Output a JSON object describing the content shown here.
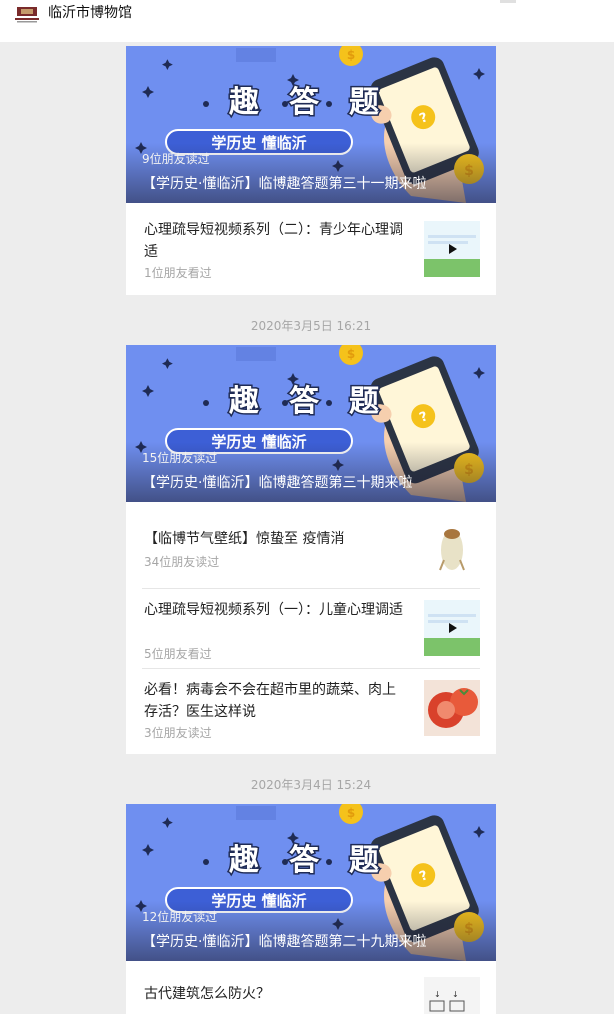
{
  "header": {
    "title": "临沂市博物馆",
    "logo_icon": "museum-logo-icon"
  },
  "colors": {
    "hero_blue": "#6f8ff0",
    "coin": "#f5c21b",
    "pill": "#3d5fd6"
  },
  "groups": [
    {
      "date": "",
      "hero": {
        "banner_text": "趣答题",
        "banner_sub": "学历史·懂临沂",
        "read": "9位朋友读过",
        "title": "【学历史·懂临沂】临博趣答题第三十一期来啦"
      },
      "items": [
        {
          "title": "心理疏导短视频系列（二）：青少年心理调适",
          "read": "1位朋友看过",
          "thumb": "video-thumbnail"
        }
      ]
    },
    {
      "date": "2020年3月5日 16:21",
      "hero": {
        "banner_text": "趣答题",
        "banner_sub": "学历史·懂临沂",
        "read": "15位朋友读过",
        "title": "【学历史·懂临沂】临博趣答题第三十期来啦"
      },
      "items": [
        {
          "title": "【临博节气壁纸】惊蛰至  疫情消",
          "read": "34位朋友读过",
          "thumb": "cicada-thumbnail"
        },
        {
          "title": "心理疏导短视频系列（一）：儿童心理调适",
          "read": "5位朋友看过",
          "thumb": "video-thumbnail"
        },
        {
          "title": "必看！病毒会不会在超市里的蔬菜、肉上存活？医生这样说",
          "read": "3位朋友读过",
          "thumb": "tomato-thumbnail"
        }
      ]
    },
    {
      "date": "2020年3月4日 15:24",
      "hero": {
        "banner_text": "趣答题",
        "banner_sub": "学历史·懂临沂",
        "read": "12位朋友读过",
        "title": "【学历史·懂临沂】临博趣答题第二十九期来啦"
      },
      "items": [
        {
          "title": "古代建筑怎么防火？",
          "read": "",
          "thumb": "diagram-thumbnail"
        }
      ]
    }
  ]
}
